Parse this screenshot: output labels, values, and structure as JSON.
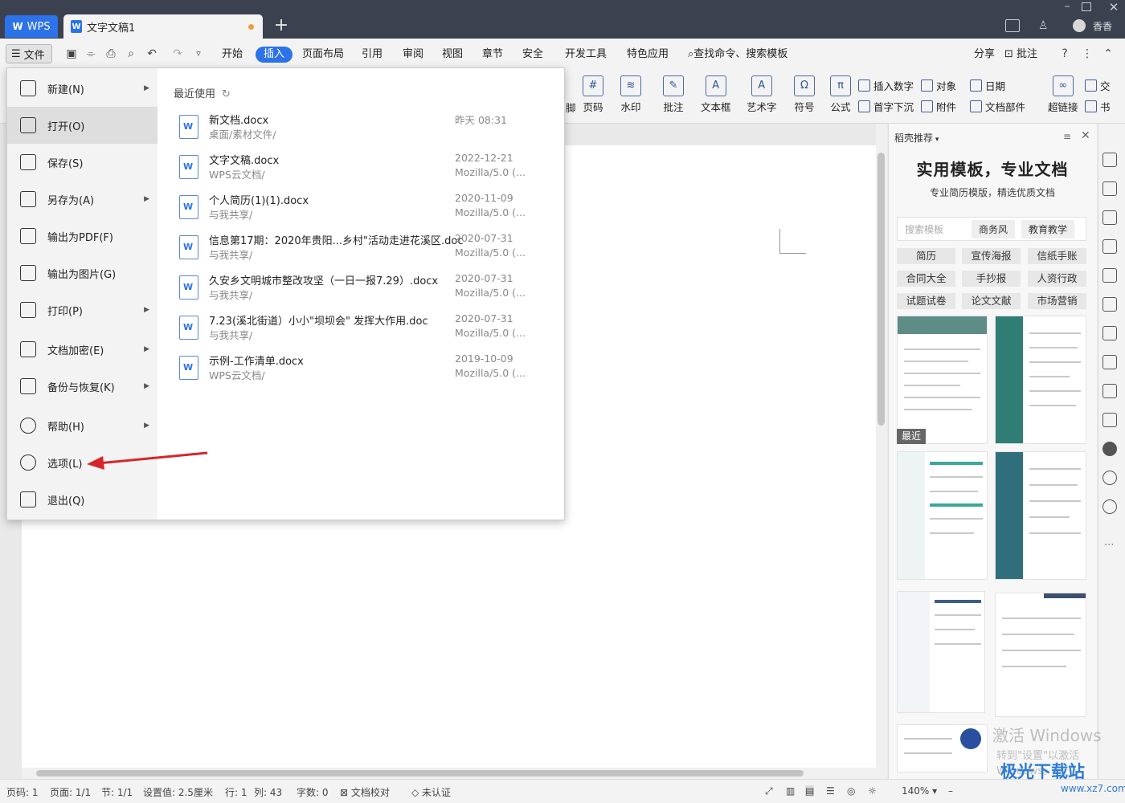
{
  "titlebar": {
    "app": "WPS",
    "doc_tab": "文字文稿1",
    "user": "香香"
  },
  "menubar": {
    "file": "文件",
    "tabs": [
      "开始",
      "插入",
      "页面布局",
      "引用",
      "审阅",
      "视图",
      "章节",
      "安全",
      "开发工具",
      "特色应用"
    ],
    "active_tab": "插入",
    "search": "查找命令、搜索模板",
    "right": [
      "分享",
      "批注"
    ]
  },
  "ribbon": {
    "big": [
      "脚",
      "页码",
      "水印",
      "批注",
      "文本框",
      "艺术字",
      "符号",
      "公式",
      "超链接"
    ],
    "small": [
      "插入数字",
      "对象",
      "日期",
      "首字下沉",
      "附件",
      "文档部件",
      "交",
      "书"
    ]
  },
  "filemenu": {
    "items": [
      {
        "label": "新建(N)",
        "arrow": true
      },
      {
        "label": "打开(O)",
        "arrow": false
      },
      {
        "label": "保存(S)",
        "arrow": false
      },
      {
        "label": "另存为(A)",
        "arrow": true
      },
      {
        "label": "输出为PDF(F)",
        "arrow": false
      },
      {
        "label": "输出为图片(G)",
        "arrow": false
      },
      {
        "label": "打印(P)",
        "arrow": true
      },
      {
        "label": "文档加密(E)",
        "arrow": true
      },
      {
        "label": "备份与恢复(K)",
        "arrow": true
      },
      {
        "label": "帮助(H)",
        "arrow": true
      },
      {
        "label": "选项(L)",
        "arrow": false
      },
      {
        "label": "退出(Q)",
        "arrow": false
      }
    ],
    "recent_title": "最近使用",
    "recent_files": [
      {
        "name": "新文档.docx",
        "path": "桌面/素材文件/",
        "date": "昨天 08:31",
        "source": ""
      },
      {
        "name": "文字文稿.docx",
        "path": "WPS云文档/",
        "date": "2022-12-21",
        "source": "Mozilla/5.0 (..."
      },
      {
        "name": "个人简历(1)(1).docx",
        "path": "与我共享/",
        "date": "2020-11-09",
        "source": "Mozilla/5.0 (..."
      },
      {
        "name": "信息第17期：2020年贵阳...乡村\"活动走进花溪区.doc",
        "path": "与我共享/",
        "date": "2020-07-31",
        "source": "Mozilla/5.0 (..."
      },
      {
        "name": "久安乡文明城市整改攻坚（一日一报7.29）.docx",
        "path": "与我共享/",
        "date": "2020-07-31",
        "source": "Mozilla/5.0 (..."
      },
      {
        "name": "7.23(溪北街道）小小\"坝坝会\" 发挥大作用.doc",
        "path": "与我共享/",
        "date": "2020-07-31",
        "source": "Mozilla/5.0 (..."
      },
      {
        "name": "示例-工作清单.docx",
        "path": "WPS云文档/",
        "date": "2019-10-09",
        "source": "Mozilla/5.0 (..."
      }
    ]
  },
  "panel": {
    "title": "稻壳推荐",
    "headline": "实用模板，专业文档",
    "subline": "专业简历模版，精选优质文档",
    "search_placeholder": "搜索模板",
    "search_chips": [
      "商务风",
      "教育教学"
    ],
    "tags": [
      "简历",
      "宣传海报",
      "信纸手账",
      "合同大全",
      "手抄报",
      "人资行政",
      "试题试卷",
      "论文文献",
      "市场营销"
    ],
    "recent_badge": "最近"
  },
  "statusbar": {
    "items": [
      "页码: 1",
      "页面: 1/1",
      "节: 1/1",
      "设置值: 2.5厘米",
      "行: 1",
      "列: 43",
      "字数: 0",
      "文档校对",
      "未认证"
    ],
    "zoom": "140%"
  },
  "watermark": {
    "line1": "激活 Windows",
    "line2": "转到\"设置\"以激活 Windows。",
    "logo": "极光下载站",
    "url": "www.xz7.com"
  },
  "colors": {
    "accent": "#2c72e8",
    "titlebar": "#3c4150",
    "arrow": "#d6262b"
  }
}
